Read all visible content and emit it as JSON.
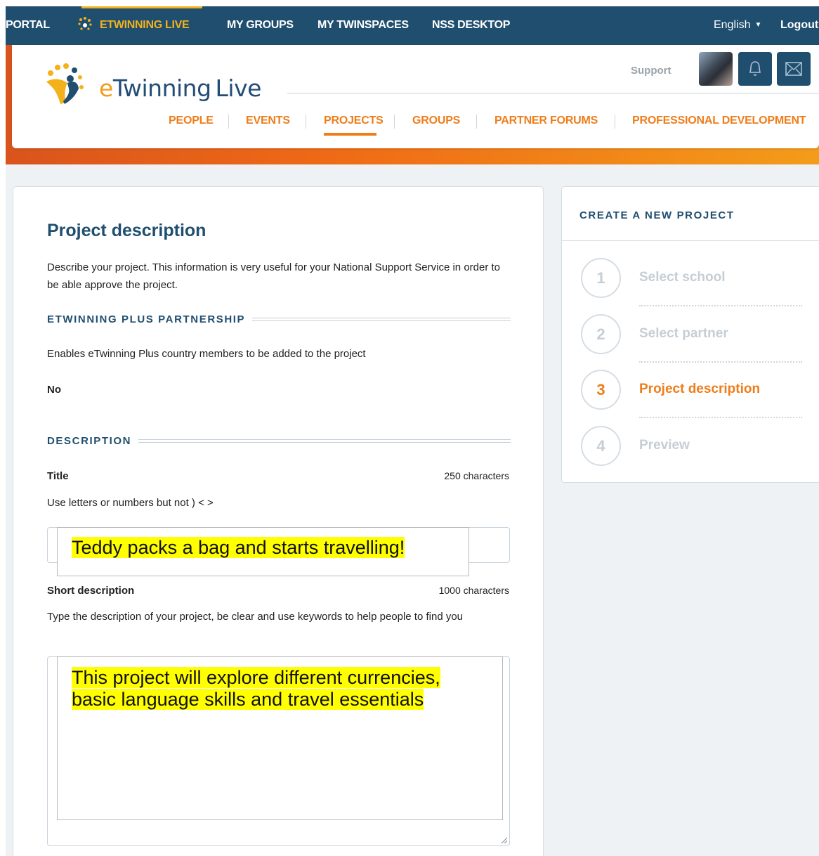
{
  "topbar": {
    "items": [
      "PORTAL",
      "ETWINNING LIVE",
      "MY GROUPS",
      "MY TWINSPACES",
      "NSS DESKTOP"
    ],
    "language": "English",
    "logout": "Logout"
  },
  "header": {
    "logo_e": "e",
    "logo_twinning": "Twinning",
    "logo_live": "Live",
    "support": "Support",
    "nav": [
      "PEOPLE",
      "EVENTS",
      "PROJECTS",
      "GROUPS",
      "PARTNER FORUMS",
      "PROFESSIONAL DEVELOPMENT"
    ],
    "active_nav": "PROJECTS"
  },
  "form": {
    "title": "Project description",
    "intro": "Describe your project. This information is very useful for your National Support Service in order to be able approve the project.",
    "plus_heading": "ETWINNING PLUS PARTNERSHIP",
    "plus_text": "Enables eTwinning Plus country members to be added to the project",
    "plus_value": "No",
    "desc_heading": "DESCRIPTION",
    "title_label": "Title",
    "title_limit": "250 characters",
    "title_hint": "Use letters or numbers but not ) < >",
    "title_value": "Teddy packs a bag and starts travelling!",
    "short_label": "Short description",
    "short_limit": "1000 characters",
    "short_hint": "Type the description of your project, be clear and use keywords to help people to find you",
    "short_value_line1": "This project will explore different currencies,",
    "short_value_line2": "basic language skills and travel essentials"
  },
  "sidebar": {
    "title": "CREATE A NEW PROJECT",
    "steps": [
      {
        "num": "1",
        "label": "Select school"
      },
      {
        "num": "2",
        "label": "Select partner"
      },
      {
        "num": "3",
        "label": "Project description"
      },
      {
        "num": "4",
        "label": "Preview"
      }
    ],
    "active_step": 3
  },
  "colors": {
    "navy": "#1f4e6f",
    "orange": "#ee7d1a",
    "gold": "#f3b21c",
    "highlight": "#ffff00"
  }
}
